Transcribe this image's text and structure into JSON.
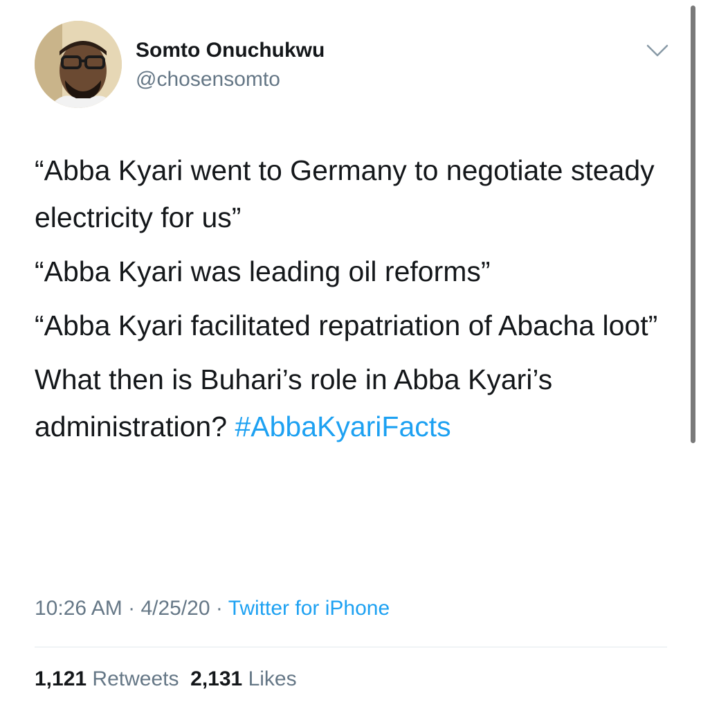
{
  "author": {
    "display_name": "Somto Onuchukwu",
    "handle": "@chosensomto"
  },
  "tweet": {
    "paragraphs": [
      "“Abba Kyari went to Germany to negotiate steady electricity for us”",
      "“Abba Kyari was leading oil reforms”",
      "“Abba Kyari facilitated repatriation of Abacha loot”"
    ],
    "final_text": "What then is Buhari’s role in Abba Kyari’s administration?",
    "hashtag": "#AbbaKyariFacts"
  },
  "meta": {
    "time": "10:26 AM",
    "separator": "·",
    "date": "4/25/20",
    "source": "Twitter for iPhone"
  },
  "stats": {
    "retweets_count": "1,121",
    "retweets_label": "Retweets",
    "likes_count": "2,131",
    "likes_label": "Likes"
  },
  "icons": {
    "menu": "chevron-down-icon"
  },
  "colors": {
    "text": "#14171a",
    "secondary": "#657786",
    "link": "#1da1f2",
    "divider": "#e1e8ed"
  }
}
